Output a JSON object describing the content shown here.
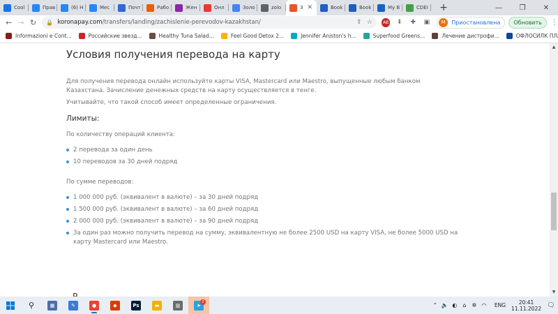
{
  "browser": {
    "tabs": [
      {
        "label": "Cool",
        "color": "#1a73e8"
      },
      {
        "label": "Прав",
        "color": "#2787f5"
      },
      {
        "label": "(6) Н",
        "color": "#2787f5"
      },
      {
        "label": "Мес",
        "color": "#2787f5"
      },
      {
        "label": "Почт",
        "color": "#3367d6"
      },
      {
        "label": "Рабо",
        "color": "#f25c05"
      },
      {
        "label": "Жен",
        "color": "#8e24aa"
      },
      {
        "label": "Онл",
        "color": "#e53935"
      },
      {
        "label": "Золо",
        "color": "#4285f4"
      },
      {
        "label": "zolo",
        "color": "#5f6368"
      },
      {
        "label": "З",
        "color": "#e8542c",
        "active": true
      },
      {
        "label": "Book",
        "color": "#1e5fbf"
      },
      {
        "label": "Book",
        "color": "#1e5fbf"
      },
      {
        "label": "My B",
        "color": "#1565c0"
      },
      {
        "label": "CDEI",
        "color": "#43a047"
      }
    ],
    "url_domain": "koronapay.com",
    "url_path": "/transfers/landing/zachislenie-perevodov-kazakhstan/",
    "profile_initial": "M",
    "profile_status": "Приостановлена",
    "update_label": "Обновить",
    "ext_badge": "AB"
  },
  "bookmarks": [
    {
      "label": "Informazioni e Cont...",
      "color": "#8b1a1a"
    },
    {
      "label": "Российские звезд...",
      "color": "#c62828"
    },
    {
      "label": "Healthy Tuna Salad...",
      "color": "#6d4c41"
    },
    {
      "label": "Feel Good Detox 2...",
      "color": "#ffb300"
    },
    {
      "label": "Jennifer Aniston's h...",
      "color": "#00acc1"
    },
    {
      "label": "Superfood Greens...",
      "color": "#26a69a"
    },
    {
      "label": "Лечение дистрофи...",
      "color": "#5d4037"
    },
    {
      "label": "ОФЛОСИЛК ПЛАС...",
      "color": "#0d47a1"
    }
  ],
  "page": {
    "title": "Условия получения перевода на карту",
    "intro": "Для получения перевода онлайн используйте карты VISA, Mastercard или Maestro, выпущенные любым банком Казахстана. Зачисление денежных средств на карту осуществляется в тенге.",
    "note": "Учитывайте, что такой способ имеет определенные ограничения.",
    "limits_title": "Лимиты:",
    "ops_label": "По количеству операций клиента:",
    "ops_items": [
      "2 перевода за один день",
      "10 переводов за 30 дней подряд"
    ],
    "sum_label": "По сумме переводов:",
    "sum_items": [
      "1 000 000 руб. (эквивалент в валюте) – за 30 дней подряд",
      "1 500 000 руб. (эквивалент в валюте) – за 60 дней подряд",
      "2 000 000 руб. (эквивалент в валюте) – за 90 дней подряд",
      "За один раз можно получить перевод на сумму, эквивалентную не более 2500 USD на карту VISA, не более 5000 USD на карту Mastercard или Maestro."
    ],
    "cutoff_text": "Р"
  },
  "taskbar": {
    "apps": [
      {
        "name": "file-explorer-alt",
        "color": "#4a6fa5",
        "glyph": "▦"
      },
      {
        "name": "pen-app",
        "color": "#3a7bd5",
        "glyph": "✎"
      },
      {
        "name": "chrome",
        "color": "#ea4335",
        "glyph": "●",
        "running": true
      },
      {
        "name": "office-app",
        "color": "#d83b01",
        "glyph": "◆"
      },
      {
        "name": "photoshop",
        "color": "#001e36",
        "glyph": "Ps"
      },
      {
        "name": "folder",
        "color": "#f2b200",
        "glyph": "▬"
      },
      {
        "name": "calculator",
        "color": "#6b6b6b",
        "glyph": "▥"
      },
      {
        "name": "telegram",
        "color": "#2aa3dc",
        "glyph": "➤",
        "active": true
      }
    ],
    "lang": "ENG",
    "time": "20:41",
    "date": "11.11.2022",
    "notif_count": "2"
  }
}
